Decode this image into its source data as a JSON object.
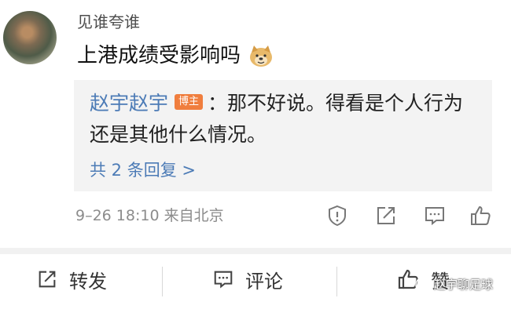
{
  "comment": {
    "username": "见谁夸谁",
    "text": "上港成绩受影响吗",
    "emoji": "doge-emoji"
  },
  "reply": {
    "author": "赵宇赵宇",
    "badge": "博主",
    "text_line1": "：那不好说。得看是个人行为",
    "text_line2": "还是其他什么情况。",
    "more_link": "共 2 条回复 >"
  },
  "meta": {
    "timestamp": "9–26 18:10 来自北京",
    "icons": [
      "report-icon",
      "share-icon",
      "comment-icon",
      "like-icon"
    ]
  },
  "actions": {
    "repost_label": "转发",
    "comment_label": "评论",
    "like_label": "赞"
  },
  "watermark": {
    "text": "赵宇聊足球"
  },
  "colors": {
    "link_blue": "#4c7bb6",
    "badge_orange": "#f07e3e",
    "reply_bg": "#f3f3f3",
    "meta_gray": "#8c8c8c"
  }
}
